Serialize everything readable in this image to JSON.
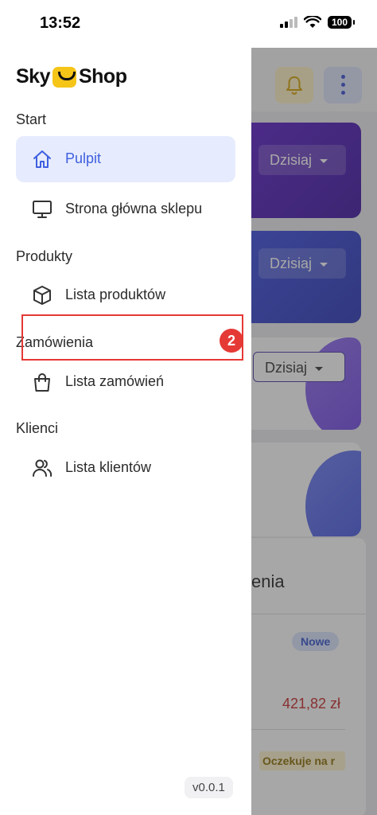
{
  "status_bar": {
    "time": "13:52",
    "battery": "100"
  },
  "background_app": {
    "dropdowns": [
      "Dzisiaj",
      "Dzisiaj",
      "Dzisiaj"
    ],
    "orders_title_fragment": "enia",
    "order_status_new": "Nowe",
    "order_price": "421,82 zł",
    "order_status_waiting": "Oczekuje na r"
  },
  "drawer": {
    "logo_left": "Sky",
    "logo_right": "Shop",
    "sections": {
      "start": "Start",
      "products": "Produkty",
      "orders": "Zamówienia",
      "clients": "Klienci"
    },
    "items": {
      "pulpit": "Pulpit",
      "store_home": "Strona główna sklepu",
      "product_list": "Lista produktów",
      "order_list": "Lista zamówień",
      "client_list": "Lista klientów"
    },
    "version": "v0.0.1"
  },
  "annotation": {
    "step_number": "2"
  },
  "colors": {
    "accent": "#3f5fe0",
    "active_bg": "#e6ecfd",
    "highlight": "#e53935",
    "logo_yellow": "#f5c518"
  }
}
